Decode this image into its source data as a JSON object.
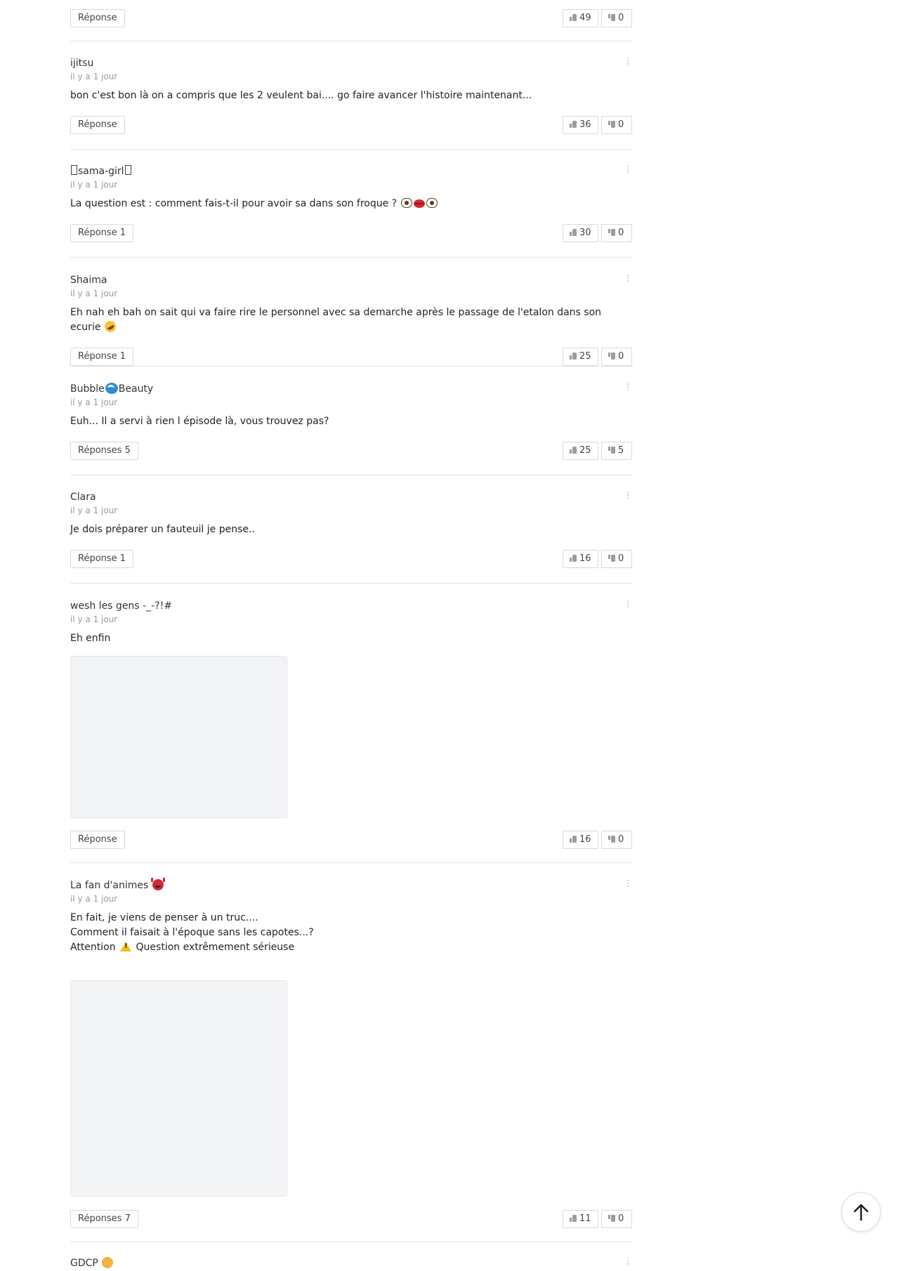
{
  "top_actions": {
    "reply_label": "Réponse",
    "likes": "49",
    "dislikes": "0"
  },
  "comments": [
    {
      "author": "ijitsu",
      "time": "il y a 1 jour",
      "text": "bon c'est bon là on a compris que les 2 veulent bai.... go faire avancer l'histoire maintenant...",
      "reply_label": "Réponse",
      "likes": "36",
      "dislikes": "0"
    },
    {
      "author": "sama-girl",
      "time": "il y a 1 jour",
      "text": "La question est : comment fais-t-il pour avoir sa dans son froque ?",
      "reply_label": "Réponse 1",
      "likes": "30",
      "dislikes": "0"
    },
    {
      "author": "Shaima",
      "time": "il y a 1 jour",
      "text": "Eh nah eh bah on sait qui va faire rire le personnel avec sa demarche après le passage de l'etalon dans son ecurie",
      "reply_label": "Réponse 1",
      "likes": "25",
      "dislikes": "0"
    },
    {
      "author_before": "Bubble",
      "author_after": "Beauty",
      "time": "il y a 1 jour",
      "text": "Euh... Il a servi à rien l épisode là, vous trouvez pas?",
      "reply_label": "Réponses 5",
      "likes": "25",
      "dislikes": "5"
    },
    {
      "author": "Clara",
      "time": "il y a 1 jour",
      "text": "Je dois préparer un fauteuil je pense..",
      "reply_label": "Réponse 1",
      "likes": "16",
      "dislikes": "0"
    },
    {
      "author": "wesh les gens -_-?!#",
      "time": "il y a 1 jour",
      "text": "Eh enfin",
      "reply_label": "Réponse",
      "likes": "16",
      "dislikes": "0"
    },
    {
      "author": "La fan d'animes",
      "time": "il y a 1 jour",
      "text_line1": "En fait, je viens de penser à un truc....",
      "text_line2": "Comment il faisait à l'époque sans les capotes...?",
      "text_line3_before": "Attention",
      "text_line3_after": "Question extrêmement sérieuse",
      "reply_label": "Réponses 7",
      "likes": "11",
      "dislikes": "0"
    },
    {
      "author": "GDCP"
    }
  ],
  "icons": {
    "like": "thumbs-up-icon",
    "dislike": "thumbs-down-icon",
    "more": "more-vertical-icon",
    "back_to_top": "arrow-up-icon"
  }
}
